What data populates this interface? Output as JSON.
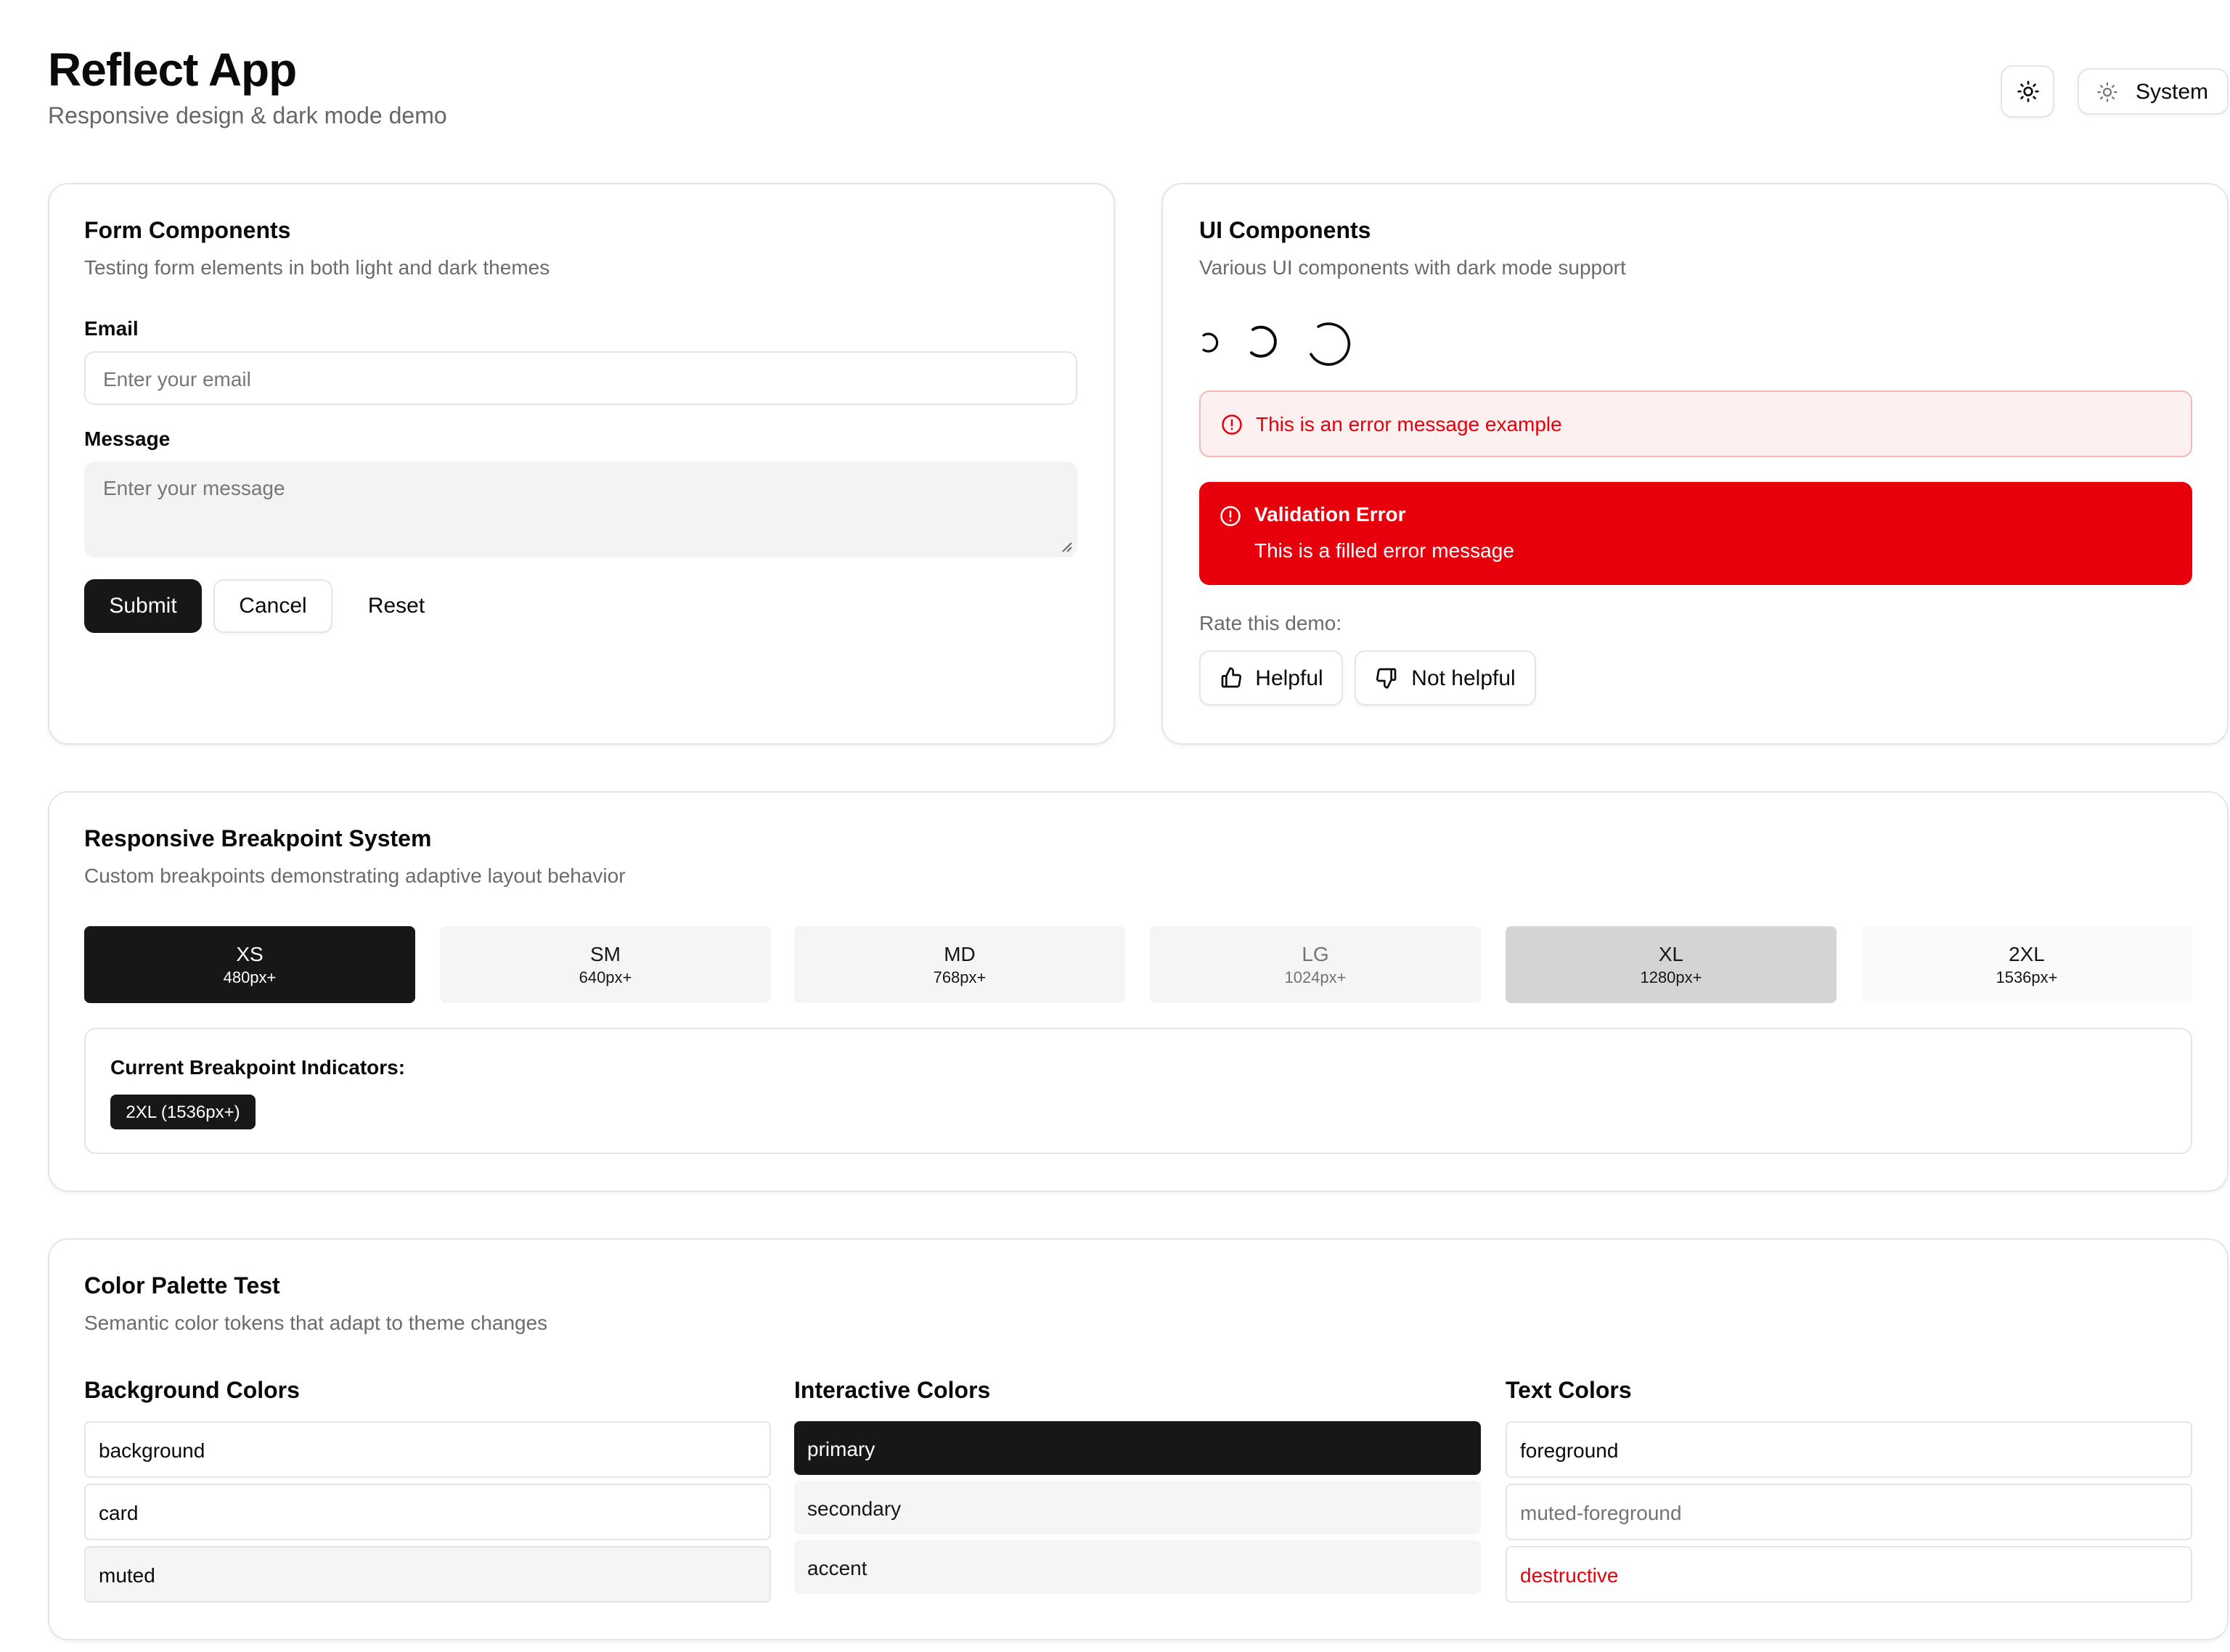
{
  "header": {
    "title": "Reflect App",
    "subtitle": "Responsive design & dark mode demo",
    "theme_icon": "sun-icon",
    "theme_select_label": "System"
  },
  "form_card": {
    "title": "Form Components",
    "description": "Testing form elements in both light and dark themes",
    "email_label": "Email",
    "email_placeholder": "Enter your email",
    "message_label": "Message",
    "message_placeholder": "Enter your message",
    "submit_label": "Submit",
    "cancel_label": "Cancel",
    "reset_label": "Reset"
  },
  "ui_card": {
    "title": "UI Components",
    "description": "Various UI components with dark mode support",
    "error_message": "This is an error message example",
    "filled_error_title": "Validation Error",
    "filled_error_text": "This is a filled error message",
    "rate_label": "Rate this demo:",
    "helpful_label": "Helpful",
    "not_helpful_label": "Not helpful"
  },
  "breakpoints_card": {
    "title": "Responsive Breakpoint System",
    "description": "Custom breakpoints demonstrating adaptive layout behavior",
    "items": [
      {
        "name": "XS",
        "value": "480px+"
      },
      {
        "name": "SM",
        "value": "640px+"
      },
      {
        "name": "MD",
        "value": "768px+"
      },
      {
        "name": "LG",
        "value": "1024px+"
      },
      {
        "name": "XL",
        "value": "1280px+"
      },
      {
        "name": "2XL",
        "value": "1536px+"
      }
    ],
    "indicator_title": "Current Breakpoint Indicators:",
    "indicator_badge": "2XL (1536px+)"
  },
  "palette_card": {
    "title": "Color Palette Test",
    "description": "Semantic color tokens that adapt to theme changes",
    "background_heading": "Background Colors",
    "background_items": [
      "background",
      "card",
      "muted"
    ],
    "interactive_heading": "Interactive Colors",
    "interactive_items": [
      "primary",
      "secondary",
      "accent"
    ],
    "text_heading": "Text Colors",
    "text_items": [
      "foreground",
      "muted-foreground",
      "destructive"
    ]
  },
  "colors": {
    "primary": "#171717",
    "destructive": "#e7000b",
    "muted": "#f5f5f5",
    "border": "#e5e5e5",
    "muted_foreground": "#737373"
  }
}
